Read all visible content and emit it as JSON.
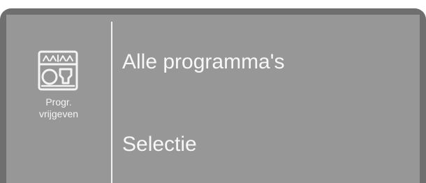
{
  "sidebar": {
    "icon": "dishwasher-rack-icon",
    "caption_line1": "Progr.",
    "caption_line2": "vrijgeven"
  },
  "menu": {
    "items": [
      {
        "label": "Alle programma's"
      },
      {
        "label": "Selectie"
      }
    ]
  },
  "colors": {
    "bezel": "#6f6f6f",
    "screen": "#979797",
    "text": "#f7f7f7"
  }
}
